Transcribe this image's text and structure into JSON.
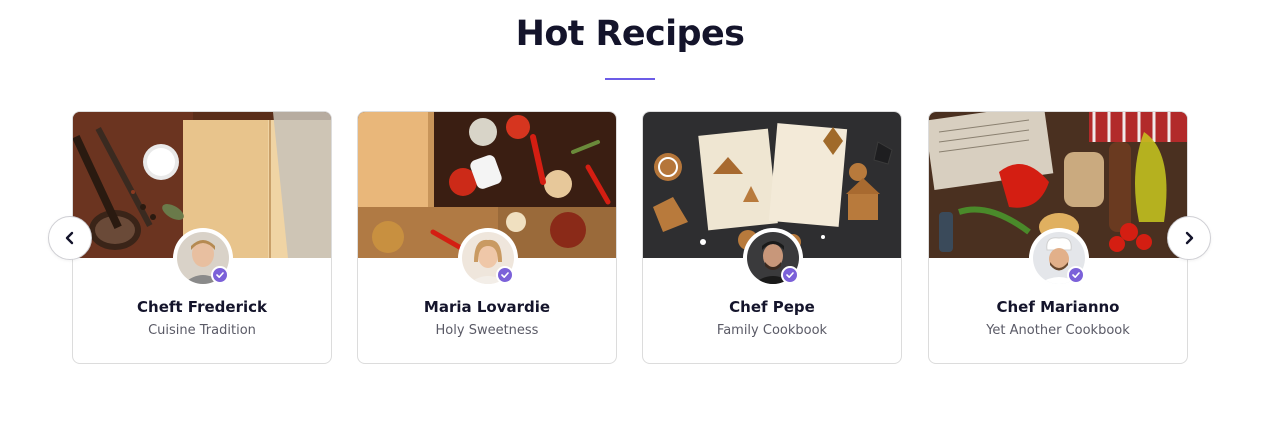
{
  "section": {
    "title": "Hot Recipes",
    "accent_color": "#6c5ce7",
    "verified_color": "#7b61d9"
  },
  "navigation": {
    "prev_icon": "chevron-left-icon",
    "next_icon": "chevron-right-icon"
  },
  "cards": [
    {
      "name": "Cheft Frederick",
      "subtitle": "Cuisine Tradition"
    },
    {
      "name": "Maria Lovardie",
      "subtitle": "Holy Sweetness"
    },
    {
      "name": "Chef Pepe",
      "subtitle": "Family Cookbook"
    },
    {
      "name": "Chef Marianno",
      "subtitle": "Yet Another Cookbook"
    }
  ]
}
